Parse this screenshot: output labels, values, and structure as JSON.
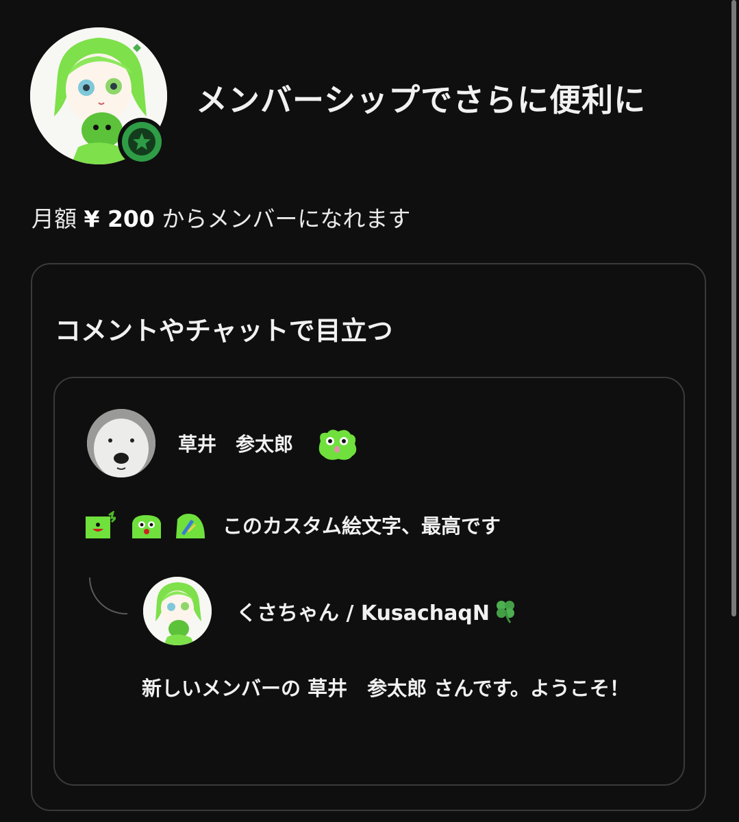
{
  "header": {
    "headline": "メンバーシップでさらに便利に",
    "price_prefix": "月額",
    "price": "¥ 200",
    "price_suffix": "からメンバーになれます"
  },
  "feature": {
    "title": "コメントやチャットで目立つ"
  },
  "comment": {
    "author": "草井　参太郎",
    "text": "このカスタム絵文字、最高です"
  },
  "reply": {
    "author": "くさちゃん / KusachaqN",
    "author_emoji": "clover-icon",
    "text": "新しいメンバーの 草井　参太郎 さんです。ようこそ！"
  },
  "colors": {
    "background": "#0f0f0f",
    "accent_green": "#2e9d46",
    "emoji_green": "#6fe03c",
    "border": "#3a3a3a"
  }
}
